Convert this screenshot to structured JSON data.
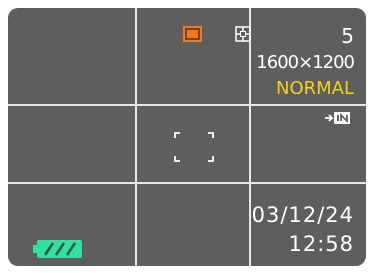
{
  "status": {
    "shots_remaining": "5",
    "image_size": "1600×1200",
    "quality": "NORMAL",
    "date": "03/12/24",
    "time": "12:58"
  },
  "icons": {
    "flash": "flash-mode-icon",
    "focus": "focus-mode-icon",
    "storage": "internal-memory-icon",
    "af_frame": "autofocus-frame",
    "battery": "battery-full-icon"
  },
  "colors": {
    "screen_bg": "#5e5e5e",
    "grid": "#e8e8e8",
    "text": "#ffffff",
    "quality_text": "#f2d21a",
    "flash_icon": "#f07820",
    "battery": "#34e0a0"
  },
  "battery_level": 1.0
}
